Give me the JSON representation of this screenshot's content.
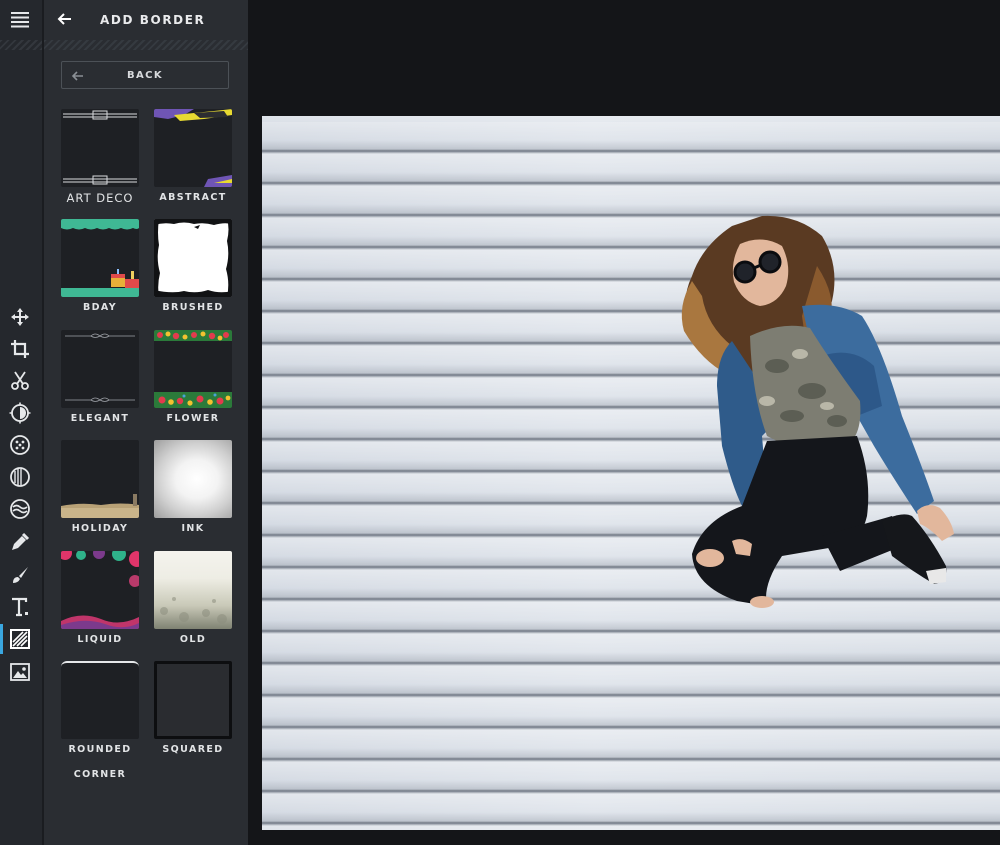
{
  "panel": {
    "title": "ADD BORDER",
    "back_label": "BACK"
  },
  "tools": [
    {
      "name": "move-icon"
    },
    {
      "name": "crop-icon"
    },
    {
      "name": "cut-icon"
    },
    {
      "name": "adjust-icon"
    },
    {
      "name": "effects-icon"
    },
    {
      "name": "contrast-icon"
    },
    {
      "name": "waves-icon"
    },
    {
      "name": "eyedropper-icon"
    },
    {
      "name": "brush-icon"
    },
    {
      "name": "text-icon"
    },
    {
      "name": "border-icon",
      "active": true
    },
    {
      "name": "image-icon"
    }
  ],
  "borders": [
    {
      "label": "ART DECO"
    },
    {
      "label": "ABSTRACT"
    },
    {
      "label": "BDAY"
    },
    {
      "label": "BRUSHED"
    },
    {
      "label": "ELEGANT"
    },
    {
      "label": "FLOWER"
    },
    {
      "label": "HOLIDAY"
    },
    {
      "label": "INK"
    },
    {
      "label": "LIQUID"
    },
    {
      "label": "OLD"
    },
    {
      "label": "ROUNDED",
      "label2": "CORNER"
    },
    {
      "label": "SQUARED"
    }
  ],
  "colors": {
    "accent": "#3aa7e0",
    "rail": "#25282d",
    "panel": "#2a2d32",
    "workspace": "#141518"
  }
}
